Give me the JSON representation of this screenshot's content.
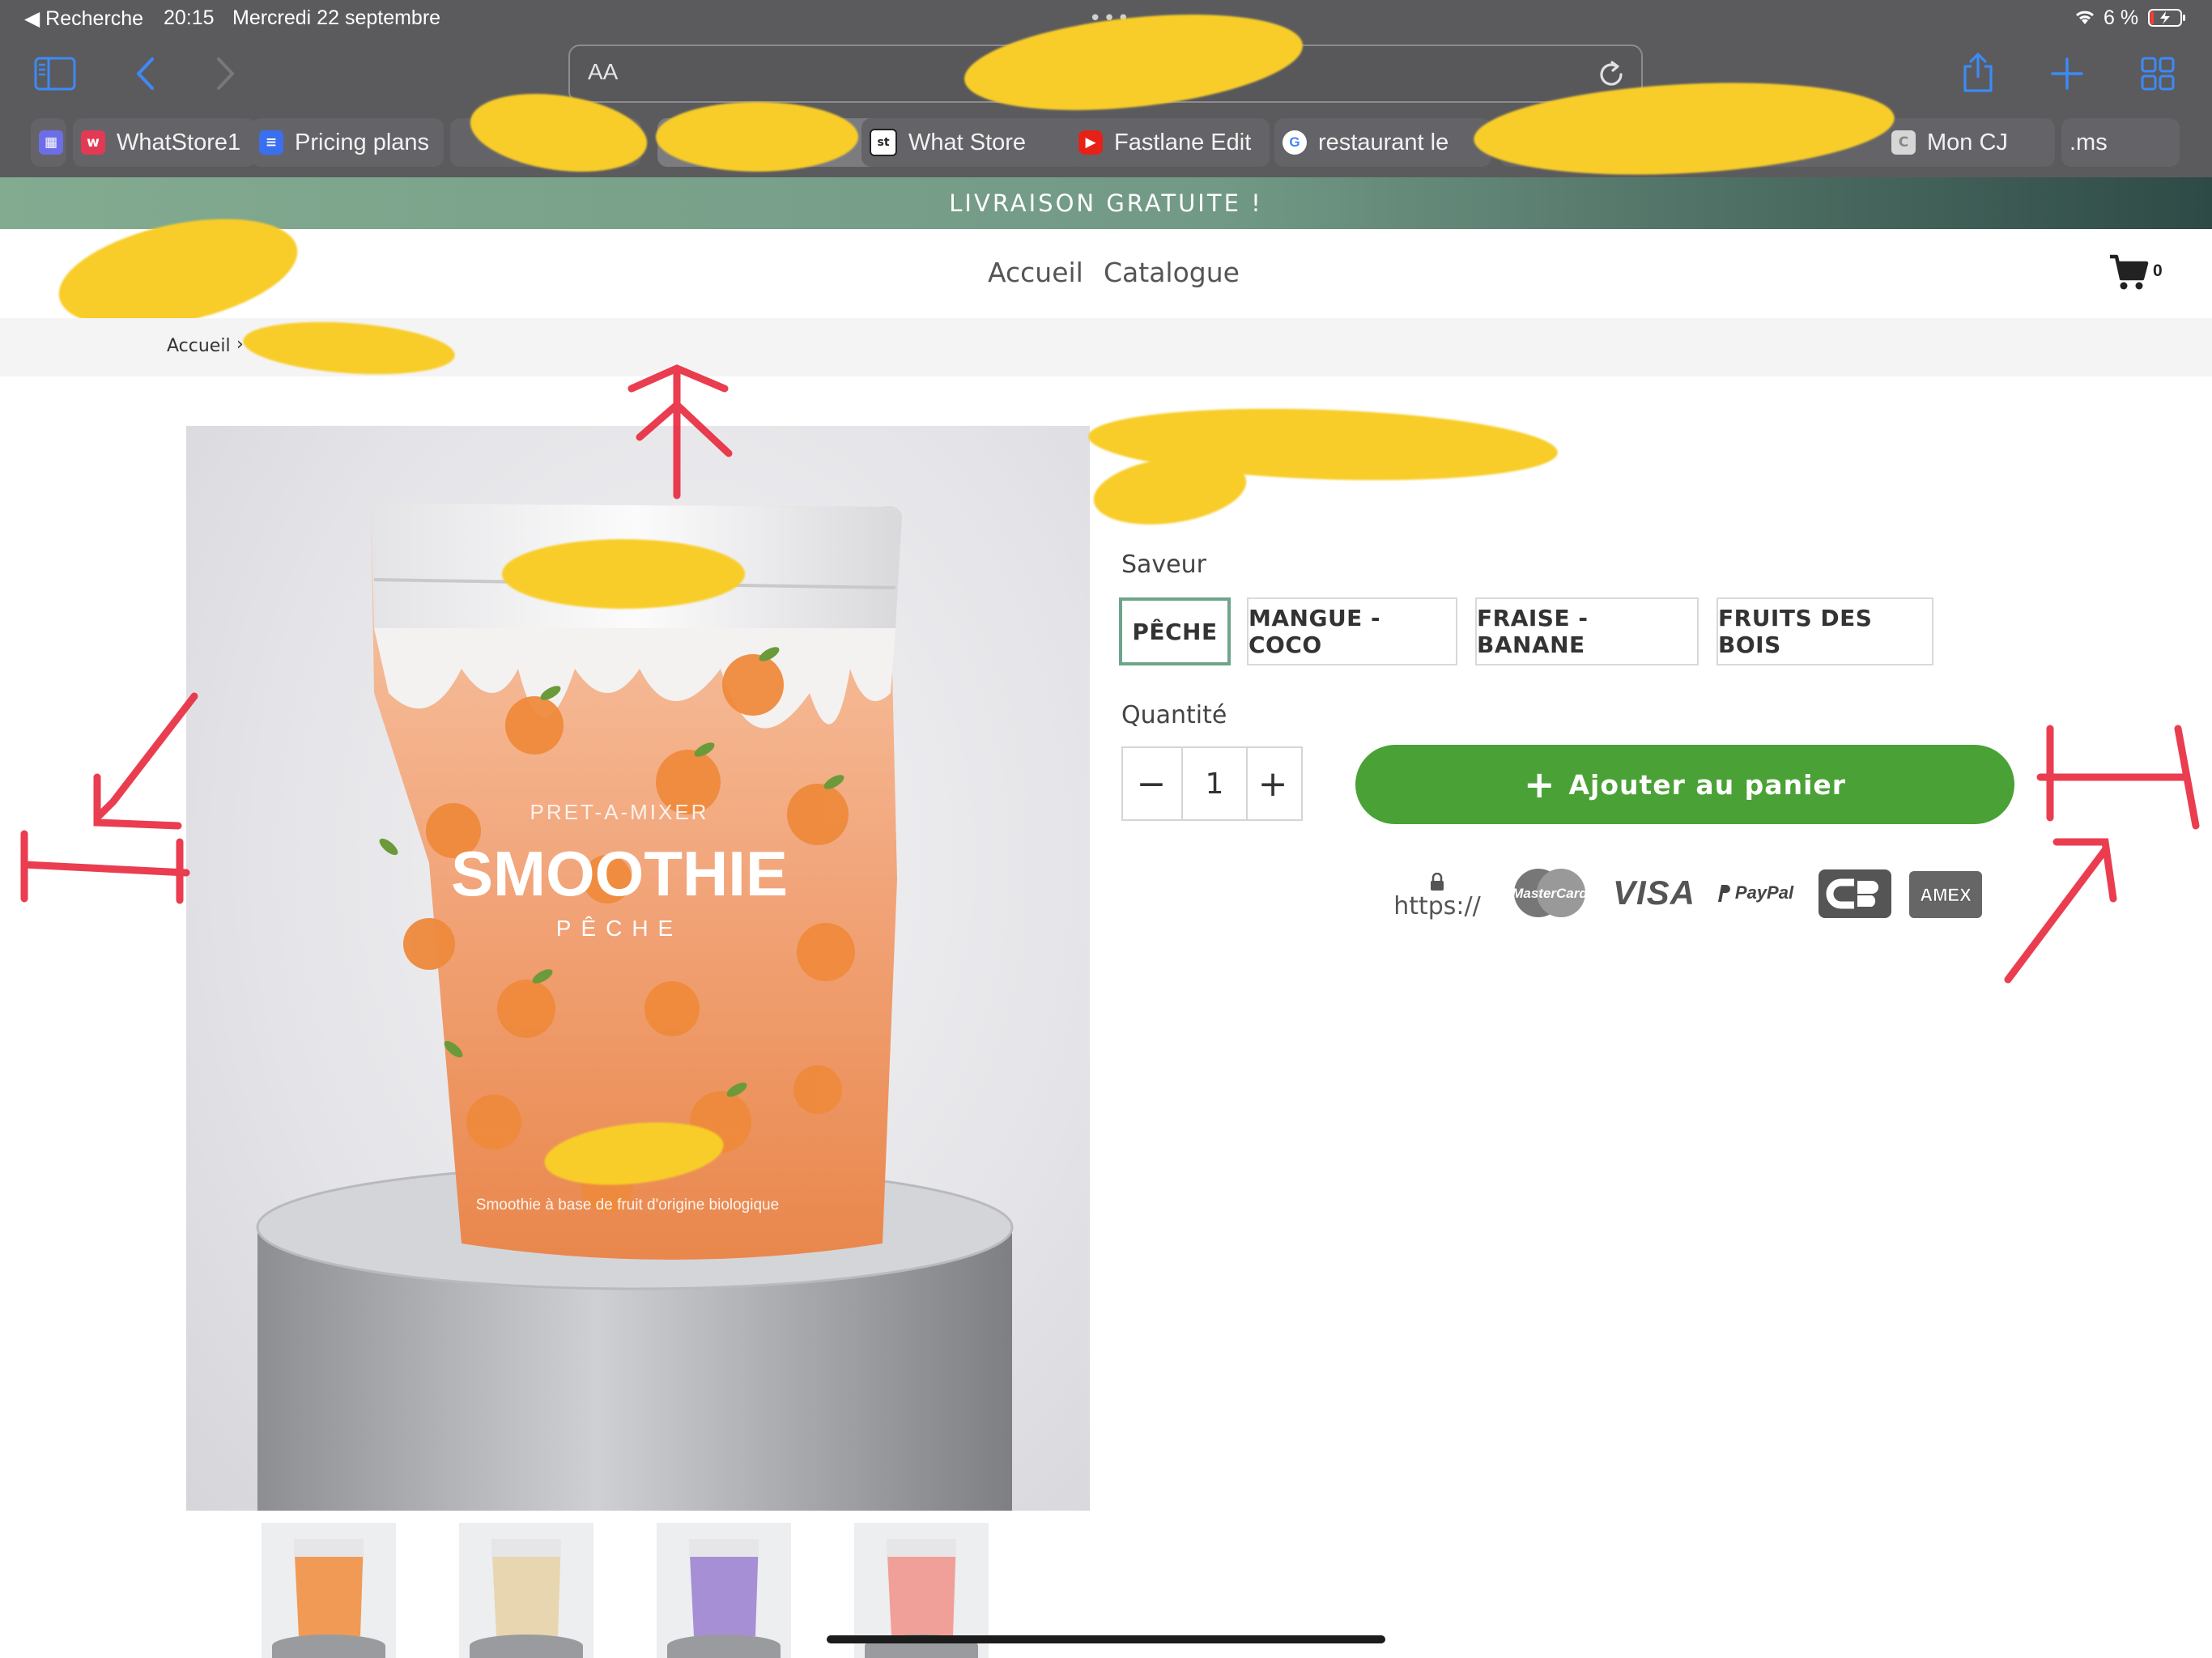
{
  "status_bar": {
    "back_app": "◀ Recherche",
    "time": "20:15",
    "date": "Mercredi 22 septembre",
    "battery": "6 %"
  },
  "browser": {
    "url_text_size": "AA",
    "tabs": [
      {
        "title": "",
        "favicon": "grid-icon",
        "color": "#6d6de8"
      },
      {
        "title": "WhatStore1",
        "favicon": "w-icon",
        "color": "#e23a55"
      },
      {
        "title": "Pricing plans",
        "favicon": "stack-icon",
        "color": "#3a6ff0"
      },
      {
        "title": "",
        "favicon": "",
        "color": ""
      },
      {
        "title": "",
        "favicon": "",
        "color": ""
      },
      {
        "title": "What Store",
        "favicon": "st-icon",
        "color": "#ffffff"
      },
      {
        "title": "Fastlane Edit",
        "favicon": "youtube-icon",
        "color": "#e62117"
      },
      {
        "title": "restaurant le",
        "favicon": "google-icon",
        "color": "#ffffff"
      },
      {
        "title": "",
        "favicon": "",
        "color": ""
      },
      {
        "title": "Mon CJ",
        "favicon": "c-icon",
        "color": "#d6d6d6"
      },
      {
        "title": ".ms",
        "favicon": "",
        "color": ""
      }
    ]
  },
  "announcement": "LIVRAISON GRATUITE !",
  "nav": {
    "links": [
      "Accueil",
      "Catalogue"
    ],
    "cart_count": "0"
  },
  "breadcrumb": {
    "home": "Accueil",
    "separator": "›"
  },
  "product": {
    "image_text": {
      "tagline": "PRET-A-MIXER",
      "name": "SMOOTHIE",
      "flavor": "PÊCHE",
      "footnote": "Smoothie à base de fruit d'origine biologique"
    },
    "flavor_label": "Saveur",
    "flavors": [
      "PÊCHE",
      "MANGUE - COCO",
      "FRAISE - BANANE",
      "FRUITS DES BOIS"
    ],
    "selected_flavor": "PÊCHE",
    "quantity_label": "Quantité",
    "quantity": "1",
    "qty_minus": "−",
    "qty_plus": "+",
    "add_to_cart_icon": "+",
    "add_to_cart": "Ajouter au panier",
    "payment_badges": {
      "https": "https://",
      "mastercard": "MasterCard",
      "visa": "VISA",
      "paypal": "PayPal",
      "amex": "AMEX"
    },
    "thumbnail_colors": [
      "#f09a55",
      "#e8d6b0",
      "#a78fd6",
      "#f0a098"
    ]
  },
  "colors": {
    "accent_green": "#4aa135",
    "selected_border": "#6ea48b",
    "annotation_red": "#e8293d",
    "redaction_yellow": "#f8cd2a"
  }
}
